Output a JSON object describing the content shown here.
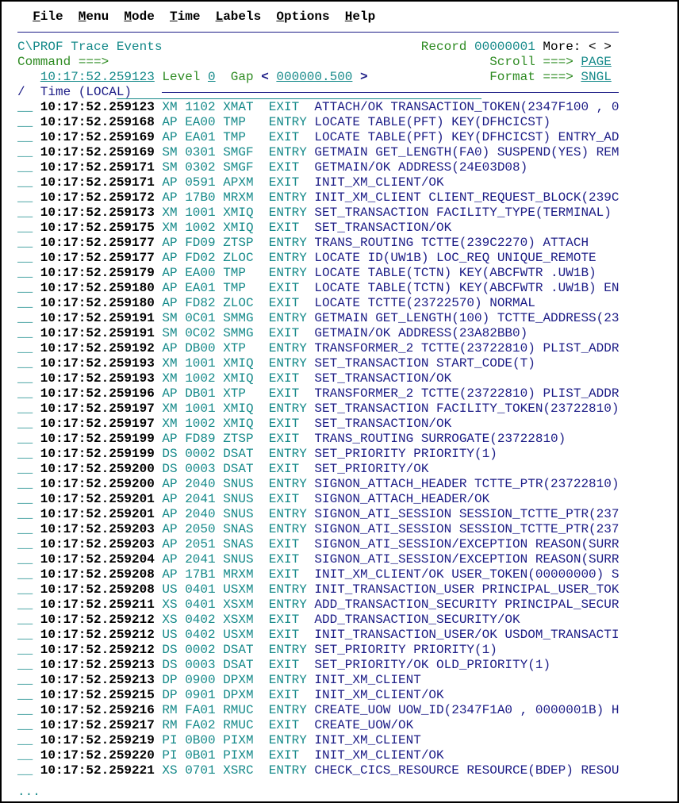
{
  "menu": [
    {
      "hot": "F",
      "rest": "ile"
    },
    {
      "hot": "M",
      "rest": "enu"
    },
    {
      "hot": "M",
      "rest": "ode"
    },
    {
      "hot": "T",
      "rest": "ime"
    },
    {
      "hot": "L",
      "rest": "abels"
    },
    {
      "hot": "O",
      "rest": "ptions"
    },
    {
      "hot": "H",
      "rest": "elp"
    }
  ],
  "header": {
    "title": "C\\PROF Trace Events",
    "record_label": "Record",
    "record_value": "00000001",
    "more": "More: < >",
    "command_label": "Command ===>",
    "command_value": "",
    "scroll_label": "Scroll ===>",
    "scroll_value": "PAGE",
    "start_time": "10:17:52.259123",
    "level_label": "Level",
    "level_value": "0",
    "gap_label": "Gap",
    "gap_lt": "<",
    "gap_value": "000000.500",
    "gap_gt": ">",
    "format_label": "Format ===>",
    "format_value": "SNGL",
    "sel_col": "/",
    "time_col": "Time (LOCAL)"
  },
  "colors": {
    "label": "#2e8b22",
    "value": "#168a8a",
    "text": "#1c1c86"
  },
  "rows": [
    [
      "10:17:52.259123",
      "XM",
      "1102",
      "XMAT",
      "EXIT",
      "ATTACH/OK TRANSACTION_TOKEN(2347F100 , 0"
    ],
    [
      "10:17:52.259168",
      "AP",
      "EA00",
      "TMP",
      "ENTRY",
      "LOCATE TABLE(PFT) KEY(DFHCICST)"
    ],
    [
      "10:17:52.259169",
      "AP",
      "EA01",
      "TMP",
      "EXIT",
      "LOCATE TABLE(PFT) KEY(DFHCICST) ENTRY_AD"
    ],
    [
      "10:17:52.259169",
      "SM",
      "0301",
      "SMGF",
      "ENTRY",
      "GETMAIN GET_LENGTH(FA0) SUSPEND(YES) REM"
    ],
    [
      "10:17:52.259171",
      "SM",
      "0302",
      "SMGF",
      "EXIT",
      "GETMAIN/OK ADDRESS(24E03D08)"
    ],
    [
      "10:17:52.259171",
      "AP",
      "0591",
      "APXM",
      "EXIT",
      "INIT_XM_CLIENT/OK"
    ],
    [
      "10:17:52.259172",
      "AP",
      "17B0",
      "MRXM",
      "ENTRY",
      "INIT_XM_CLIENT CLIENT_REQUEST_BLOCK(239C"
    ],
    [
      "10:17:52.259173",
      "XM",
      "1001",
      "XMIQ",
      "ENTRY",
      "SET_TRANSACTION FACILITY_TYPE(TERMINAL)"
    ],
    [
      "10:17:52.259175",
      "XM",
      "1002",
      "XMIQ",
      "EXIT",
      "SET_TRANSACTION/OK"
    ],
    [
      "10:17:52.259177",
      "AP",
      "FD09",
      "ZTSP",
      "ENTRY",
      "TRANS_ROUTING TCTTE(239C2270) ATTACH"
    ],
    [
      "10:17:52.259177",
      "AP",
      "FD02",
      "ZLOC",
      "ENTRY",
      "LOCATE ID(UW1B) LOC_REQ UNIQUE_REMOTE"
    ],
    [
      "10:17:52.259179",
      "AP",
      "EA00",
      "TMP",
      "ENTRY",
      "LOCATE TABLE(TCTN) KEY(ABCFWTR .UW1B)"
    ],
    [
      "10:17:52.259180",
      "AP",
      "EA01",
      "TMP",
      "EXIT",
      "LOCATE TABLE(TCTN) KEY(ABCFWTR .UW1B) EN"
    ],
    [
      "10:17:52.259180",
      "AP",
      "FD82",
      "ZLOC",
      "EXIT",
      "LOCATE TCTTE(23722570) NORMAL"
    ],
    [
      "10:17:52.259191",
      "SM",
      "0C01",
      "SMMG",
      "ENTRY",
      "GETMAIN GET_LENGTH(100) TCTTE_ADDRESS(23"
    ],
    [
      "10:17:52.259191",
      "SM",
      "0C02",
      "SMMG",
      "EXIT",
      "GETMAIN/OK ADDRESS(23A82BB0)"
    ],
    [
      "10:17:52.259192",
      "AP",
      "DB00",
      "XTP",
      "ENTRY",
      "TRANSFORMER_2 TCTTE(23722810) PLIST_ADDR"
    ],
    [
      "10:17:52.259193",
      "XM",
      "1001",
      "XMIQ",
      "ENTRY",
      "SET_TRANSACTION START_CODE(T)"
    ],
    [
      "10:17:52.259193",
      "XM",
      "1002",
      "XMIQ",
      "EXIT",
      "SET_TRANSACTION/OK"
    ],
    [
      "10:17:52.259196",
      "AP",
      "DB01",
      "XTP",
      "EXIT",
      "TRANSFORMER_2 TCTTE(23722810) PLIST_ADDR"
    ],
    [
      "10:17:52.259197",
      "XM",
      "1001",
      "XMIQ",
      "ENTRY",
      "SET_TRANSACTION FACILITY_TOKEN(23722810)"
    ],
    [
      "10:17:52.259197",
      "XM",
      "1002",
      "XMIQ",
      "EXIT",
      "SET_TRANSACTION/OK"
    ],
    [
      "10:17:52.259199",
      "AP",
      "FD89",
      "ZTSP",
      "EXIT",
      "TRANS_ROUTING SURROGATE(23722810)"
    ],
    [
      "10:17:52.259199",
      "DS",
      "0002",
      "DSAT",
      "ENTRY",
      "SET_PRIORITY PRIORITY(1)"
    ],
    [
      "10:17:52.259200",
      "DS",
      "0003",
      "DSAT",
      "EXIT",
      "SET_PRIORITY/OK"
    ],
    [
      "10:17:52.259200",
      "AP",
      "2040",
      "SNUS",
      "ENTRY",
      "SIGNON_ATTACH_HEADER TCTTE_PTR(23722810)"
    ],
    [
      "10:17:52.259201",
      "AP",
      "2041",
      "SNUS",
      "EXIT",
      "SIGNON_ATTACH_HEADER/OK"
    ],
    [
      "10:17:52.259201",
      "AP",
      "2040",
      "SNUS",
      "ENTRY",
      "SIGNON_ATI_SESSION SESSION_TCTTE_PTR(237"
    ],
    [
      "10:17:52.259203",
      "AP",
      "2050",
      "SNAS",
      "ENTRY",
      "SIGNON_ATI_SESSION SESSION_TCTTE_PTR(237"
    ],
    [
      "10:17:52.259203",
      "AP",
      "2051",
      "SNAS",
      "EXIT",
      "SIGNON_ATI_SESSION/EXCEPTION REASON(SURR"
    ],
    [
      "10:17:52.259204",
      "AP",
      "2041",
      "SNUS",
      "EXIT",
      "SIGNON_ATI_SESSION/EXCEPTION REASON(SURR"
    ],
    [
      "10:17:52.259208",
      "AP",
      "17B1",
      "MRXM",
      "EXIT",
      "INIT_XM_CLIENT/OK USER_TOKEN(00000000) S"
    ],
    [
      "10:17:52.259208",
      "US",
      "0401",
      "USXM",
      "ENTRY",
      "INIT_TRANSACTION_USER PRINCIPAL_USER_TOK"
    ],
    [
      "10:17:52.259211",
      "XS",
      "0401",
      "XSXM",
      "ENTRY",
      "ADD_TRANSACTION_SECURITY PRINCIPAL_SECUR"
    ],
    [
      "10:17:52.259212",
      "XS",
      "0402",
      "XSXM",
      "EXIT",
      "ADD_TRANSACTION_SECURITY/OK"
    ],
    [
      "10:17:52.259212",
      "US",
      "0402",
      "USXM",
      "EXIT",
      "INIT_TRANSACTION_USER/OK USDOM_TRANSACTI"
    ],
    [
      "10:17:52.259212",
      "DS",
      "0002",
      "DSAT",
      "ENTRY",
      "SET_PRIORITY PRIORITY(1)"
    ],
    [
      "10:17:52.259213",
      "DS",
      "0003",
      "DSAT",
      "EXIT",
      "SET_PRIORITY/OK OLD_PRIORITY(1)"
    ],
    [
      "10:17:52.259213",
      "DP",
      "0900",
      "DPXM",
      "ENTRY",
      "INIT_XM_CLIENT"
    ],
    [
      "10:17:52.259215",
      "DP",
      "0901",
      "DPXM",
      "EXIT",
      "INIT_XM_CLIENT/OK"
    ],
    [
      "10:17:52.259216",
      "RM",
      "FA01",
      "RMUC",
      "ENTRY",
      "CREATE_UOW UOW_ID(2347F1A0 , 0000001B) H"
    ],
    [
      "10:17:52.259217",
      "RM",
      "FA02",
      "RMUC",
      "EXIT",
      "CREATE_UOW/OK"
    ],
    [
      "10:17:52.259219",
      "PI",
      "0B00",
      "PIXM",
      "ENTRY",
      "INIT_XM_CLIENT"
    ],
    [
      "10:17:52.259220",
      "PI",
      "0B01",
      "PIXM",
      "EXIT",
      "INIT_XM_CLIENT/OK"
    ],
    [
      "10:17:52.259221",
      "XS",
      "0701",
      "XSRC",
      "ENTRY",
      "CHECK_CICS_RESOURCE RESOURCE(BDEP) RESOU"
    ]
  ],
  "footer": "..."
}
